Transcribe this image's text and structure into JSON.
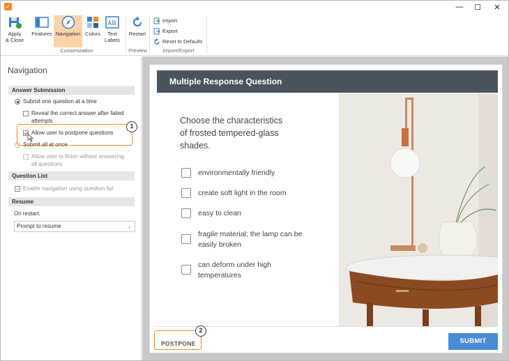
{
  "window": {
    "controls": {
      "minimize": "—",
      "maximize": "☐",
      "close": "✕"
    }
  },
  "ribbon": {
    "buttons": [
      {
        "label": "Apply\n& Close",
        "icon": "apply-close-icon"
      },
      {
        "label": "Features",
        "icon": "features-icon"
      },
      {
        "label": "Navigation",
        "icon": "navigation-compass-icon",
        "active": true
      },
      {
        "label": "Colors",
        "icon": "colors-icon"
      },
      {
        "label": "Text\nLabels",
        "icon": "text-labels-icon"
      },
      {
        "label": "Restart",
        "icon": "restart-icon"
      }
    ],
    "small_buttons": [
      {
        "label": "Import",
        "icon": "import-icon"
      },
      {
        "label": "Export",
        "icon": "export-icon"
      },
      {
        "label": "Reset to Defaults",
        "icon": "reset-icon"
      }
    ],
    "groups": {
      "customization": "Customization",
      "preview": "Preview",
      "import_export": "Import/Export"
    }
  },
  "left_panel": {
    "title": "Navigation",
    "answer_submission": {
      "header": "Answer Submission",
      "submit_one": "Submit one question at a time",
      "reveal": "Reveal the correct answer after failed attempts",
      "reveal_line1": "Reveal the correct answer after failed",
      "reveal_line2": "attempts",
      "allow_postpone": "Allow user to postpone questions",
      "submit_all": "Submit all at once",
      "allow_finish_line1": "Allow user to finish without answering",
      "allow_finish_line2": "all questions"
    },
    "question_list": {
      "header": "Question List",
      "enable_nav": "Enable navigation using question list"
    },
    "resume": {
      "header": "Resume",
      "on_restart_label": "On restart:",
      "on_restart_value": "Prompt to resume"
    },
    "callout_1": "1"
  },
  "preview": {
    "header": "Multiple Response Question",
    "question_line1": "Choose the characteristics",
    "question_line2": "of frosted tempered-glass",
    "question_line3": "shades.",
    "answers": [
      {
        "text": "environmentally friendly"
      },
      {
        "text": "create soft light in the room"
      },
      {
        "text": "easy to clean"
      },
      {
        "text": "fragile material; the lamp can be easily broken"
      },
      {
        "text": "can deform under high temperatures"
      }
    ],
    "postpone_label": "POSTPONE",
    "submit_label": "SUBMIT",
    "callout_2": "2"
  },
  "colors": {
    "accent": "#f08a24",
    "header_bg": "#4b535c",
    "submit_bg": "#4a8bd6",
    "active_ribbon": "#fbd3ab"
  }
}
